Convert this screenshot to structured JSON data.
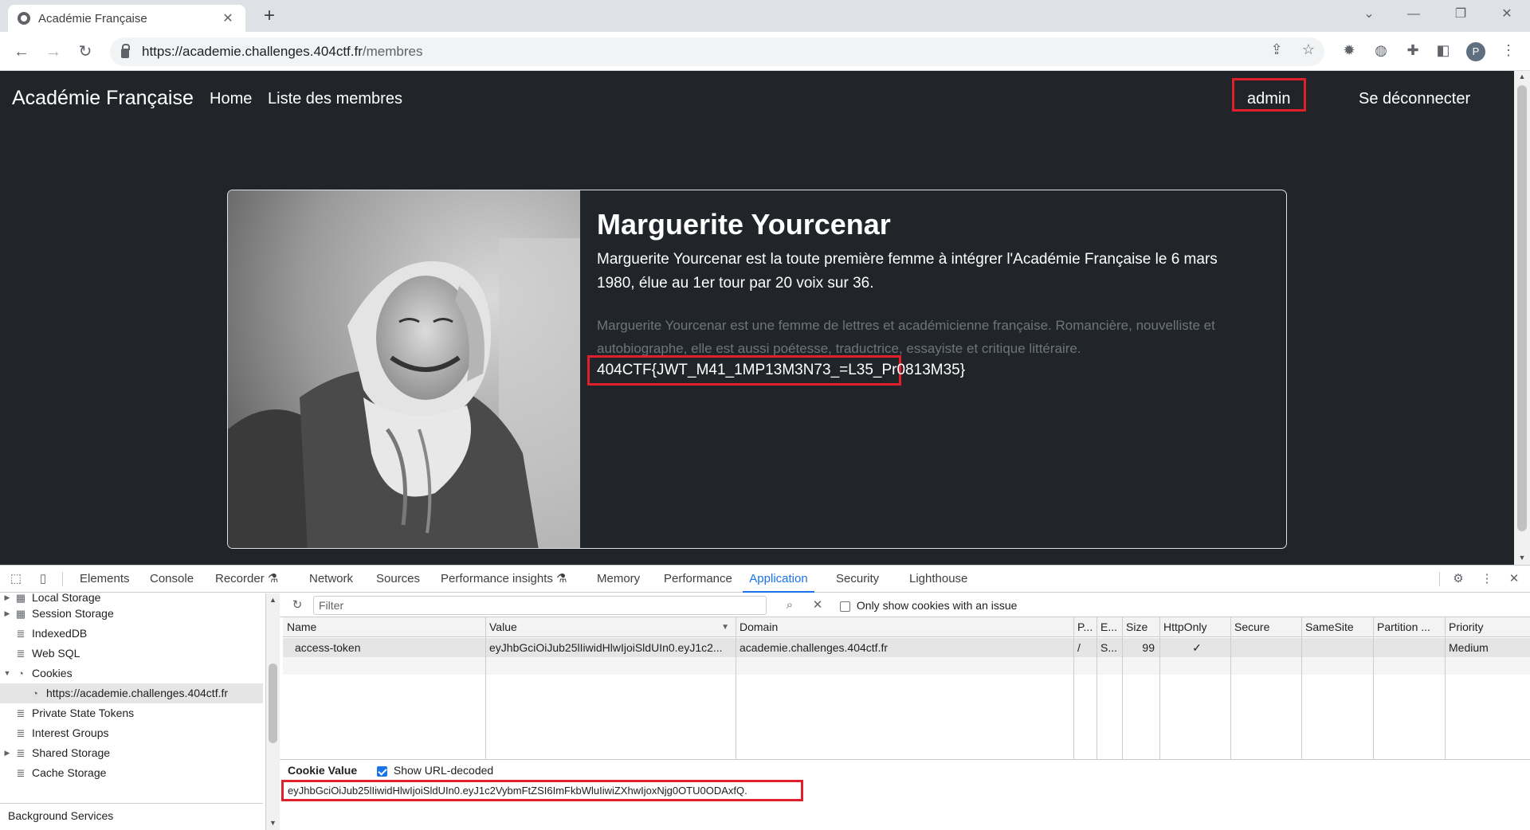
{
  "browser": {
    "tab_title": "Académie Française",
    "tab_close": "✕",
    "new_tab": "+",
    "url_host": "https://academie.challenges.404ctf.fr",
    "url_path": "/membres",
    "profile_initial": "P"
  },
  "site": {
    "brand": "Académie Française",
    "nav_home": "Home",
    "nav_members": "Liste des membres",
    "user": "admin",
    "logout": "Se déconnecter"
  },
  "member": {
    "name": "Marguerite Yourcenar",
    "lead": "Marguerite Yourcenar est la toute première femme à intégrer l'Académie Française le 6 mars 1980, élue au 1er tour par 20 voix sur 36.",
    "description": "Marguerite Yourcenar est une femme de lettres et académicienne française. Romancière, nouvelliste et autobiographe, elle est aussi poétesse, traductrice, essayiste et critique littéraire.",
    "flag": "404CTF{JWT_M41_1MP13M3N73_=L35_Pr0813M35}"
  },
  "devtools": {
    "tabs": [
      "Elements",
      "Console",
      "Recorder ⚗",
      "Network",
      "Sources",
      "Performance insights ⚗",
      "Memory",
      "Performance",
      "Application",
      "Security",
      "Lighthouse"
    ],
    "active_tab": "Application",
    "sidebar": {
      "local_storage": "Local Storage",
      "session_storage": "Session Storage",
      "indexeddb": "IndexedDB",
      "websql": "Web SQL",
      "cookies": "Cookies",
      "cookie_origin": "https://academie.challenges.404ctf.fr",
      "private_state_tokens": "Private State Tokens",
      "interest_groups": "Interest Groups",
      "shared_storage": "Shared Storage",
      "cache_storage": "Cache Storage",
      "background_services": "Background Services"
    },
    "filter_placeholder": "Filter",
    "only_issues_label": "Only show cookies with an issue",
    "columns": [
      "Name",
      "Value",
      "Domain",
      "P...",
      "E...",
      "Size",
      "HttpOnly",
      "Secure",
      "SameSite",
      "Partition ...",
      "Priority"
    ],
    "cookie_row": {
      "name": "access-token",
      "value": "eyJhbGciOiJub25lIiwidHlwIjoiSldUIn0.eyJ1c2...",
      "domain": "academie.challenges.404ctf.fr",
      "path": "/",
      "expires": "S...",
      "size": "99",
      "httponly": "✓",
      "secure": "",
      "samesite": "",
      "partition": "",
      "priority": "Medium"
    },
    "cookie_value_label": "Cookie Value",
    "show_decoded_label": "Show URL-decoded",
    "show_decoded_checked": true,
    "cookie_value_full": "eyJhbGciOiJub25lIiwidHlwIjoiSldUIn0.eyJ1c2VybmFtZSI6ImFkbWluIiwiZXhwIjoxNjg0OTU0ODAxfQ."
  },
  "colors": {
    "page_bg": "#212529",
    "highlight_red": "#e0202a",
    "devtools_accent": "#1a73e8"
  },
  "icons": [
    "globe-favicon-icon",
    "back-arrow-icon",
    "forward-arrow-icon",
    "reload-icon",
    "lock-icon",
    "share-icon",
    "star-icon",
    "extension-icon",
    "puzzle-icon",
    "sidepanel-icon",
    "kebab-menu-icon",
    "inspect-icon",
    "device-toggle-icon",
    "gear-icon",
    "close-icon",
    "refresh-icon",
    "clear-filter-icon",
    "database-icon",
    "cookie-icon",
    "grid-icon"
  ]
}
